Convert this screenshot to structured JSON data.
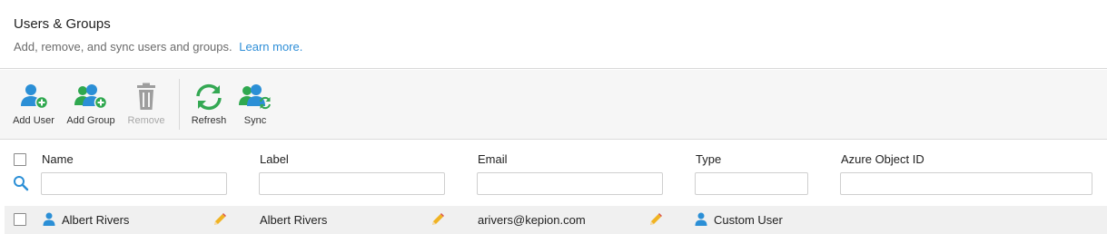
{
  "header": {
    "title": "Users & Groups",
    "subtitle": "Add, remove, and sync users and groups.",
    "learn_more": "Learn more."
  },
  "toolbar": {
    "add_user": "Add User",
    "add_group": "Add Group",
    "remove": "Remove",
    "refresh": "Refresh",
    "sync": "Sync"
  },
  "columns": {
    "name": "Name",
    "label": "Label",
    "email": "Email",
    "type": "Type",
    "azure_object_id": "Azure Object ID"
  },
  "rows": [
    {
      "name": "Albert Rivers",
      "label": "Albert Rivers",
      "email": "arivers@kepion.com",
      "type": "Custom User",
      "azure_object_id": ""
    }
  ],
  "colors": {
    "user_blue": "#2b8fd6",
    "group_green": "#2fa84f",
    "refresh_green": "#34a853",
    "pencil_yellow": "#f0b323",
    "disabled_gray": "#9e9e9e",
    "link_blue": "#2f8fd8"
  },
  "icons": [
    "add-user-icon",
    "add-group-icon",
    "trash-icon",
    "refresh-icon",
    "sync-icon",
    "search-icon",
    "pencil-icon",
    "user-icon"
  ]
}
